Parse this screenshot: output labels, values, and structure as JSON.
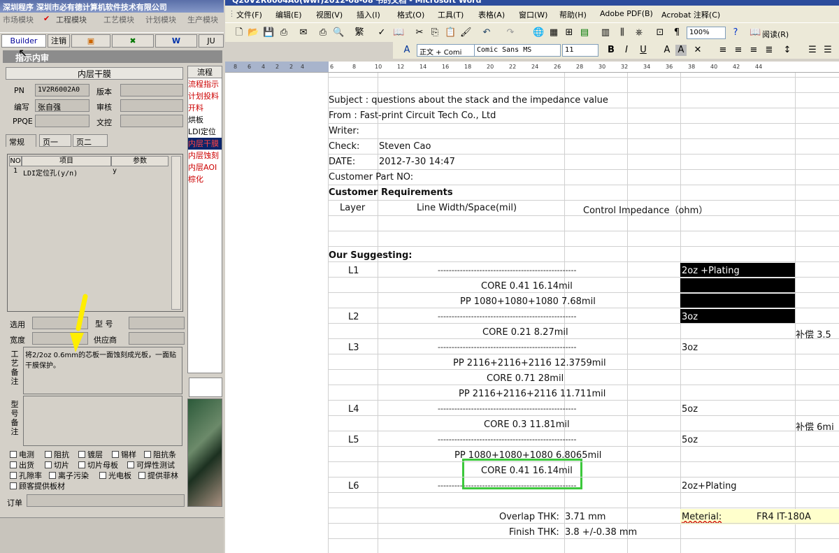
{
  "left_app": {
    "title": "深圳程序  深圳市必有德计算机软件技术有限公司",
    "menu": [
      "市场模块",
      "工程模块",
      "工艺模块",
      "计划模块",
      "生产模块"
    ],
    "toolbar": [
      "Builder",
      "注销",
      "JU"
    ],
    "window_title": "指示内审",
    "panel_header": "内层干膜",
    "pn_label": "PN",
    "pn_value": "1V2R6002A0",
    "version_label": "版本",
    "writer_label": "编写",
    "writer_value": "张自强",
    "review_label": "审核",
    "ppqe_label": "PPQE",
    "doc_label": "文控",
    "tabs": [
      "常规",
      "页一",
      "页二"
    ],
    "grid_headers": [
      "NO",
      "项目",
      "参数"
    ],
    "grid_row": {
      "no": "1",
      "item": "LDI定位孔(y/n)",
      "param": "y"
    },
    "select_label": "选用",
    "model_label": "型 号",
    "width_label": "宽度",
    "supplier_label": "供应商",
    "craft_remark_label": "工艺备注",
    "craft_remark": "将2/2oz 0.6mm的芯板一面蚀刻成光板，一面贴干膜保护。",
    "model_remark_label": "型号备注",
    "checkboxes": [
      "电测",
      "阻抗",
      "镀层",
      "锡样",
      "阻抗条",
      "出货",
      "切片",
      "切片母板",
      "可焊性测试",
      "孔隙率",
      "离子污染",
      "光电板",
      "提供菲林",
      "顾客提供板材"
    ],
    "order_label": "订单",
    "flow_header": "流程",
    "flow_items": [
      "流程指示",
      "计划投料",
      "开料",
      "烘板",
      "LDI定位",
      "内层干膜",
      "内层蚀刻",
      "内层AOI",
      "棕化"
    ]
  },
  "word": {
    "title": "Q20V2R6004A0(wwf)2012-08-08 书的文档 - Microsoft Word",
    "menu": [
      "文件(F)",
      "编辑(E)",
      "视图(V)",
      "插入(I)",
      "格式(O)",
      "工具(T)",
      "表格(A)",
      "窗口(W)",
      "帮助(H)",
      "Adobe PDF(B)",
      "Acrobat 注释(C)"
    ],
    "zoom": "100%",
    "read_label": "阅读(R)",
    "style": "正文 + Comi",
    "font": "Comic Sans MS",
    "size": "11",
    "ruler": [
      "8",
      "6",
      "4",
      "2",
      "2",
      "4",
      "6",
      "8",
      "10",
      "12",
      "14",
      "16",
      "18",
      "20",
      "22",
      "24",
      "26",
      "28",
      "30",
      "32",
      "34",
      "36",
      "38",
      "40",
      "42",
      "44"
    ]
  },
  "doc": {
    "subject": "Subject : questions about the stack and the impedance value",
    "from": "From :  Fast-print Circuit Tech Co., Ltd",
    "writer": "Writer:",
    "check_label": "Check:",
    "check_value": "Steven Cao",
    "date_label": "DATE:",
    "date_value": "2012-7-30 14:47",
    "part_no": "Customer Part NO:",
    "requirements": "Customer Requirements",
    "col_layer": "Layer",
    "col_line": "Line Width/Space(mil)",
    "col_imp": "Control Impedance（ohm）",
    "suggesting": "Our Suggesting:",
    "dashes": "--------------------------------------------------",
    "rows": [
      {
        "layer": "L1",
        "copper": "2oz +Plating"
      },
      {
        "mid": "CORE  0.41  16.14mil"
      },
      {
        "mid": "PP  1080+1080+1080  7.68mil"
      },
      {
        "layer": "L2",
        "copper": "3oz"
      },
      {
        "mid": "CORE  0.21  8.27mil",
        "extra": "补偿 3.5"
      },
      {
        "layer": "L3",
        "copper": "3oz"
      },
      {
        "mid": "PP  2116+2116+2116  12.3759mil"
      },
      {
        "mid": "CORE  0.71  28mil"
      },
      {
        "mid": "PP  2116+2116+2116  11.711mil"
      },
      {
        "layer": "L4",
        "copper": "5oz"
      },
      {
        "mid": "CORE  0.3  11.81mil",
        "extra": "补偿 6mi"
      },
      {
        "layer": "L5",
        "copper": "5oz"
      },
      {
        "mid": "PP  1080+1080+1080  6.8065mil"
      },
      {
        "mid": "CORE  0.41  16.14mil"
      },
      {
        "layer": "L6",
        "copper": "2oz+Plating"
      }
    ],
    "overlap_label": "Overlap THK:",
    "overlap_value": "3.71 mm",
    "finish_label": "Finish THK:",
    "finish_value": "3.8 +/-0.38 mm",
    "material_label": "Meterial:",
    "material_value": "FR4 IT-180A"
  },
  "colors": {
    "highlight_box": "#3cc83c",
    "arrow": "#ffee00",
    "material_bg": "#ffffcc"
  }
}
